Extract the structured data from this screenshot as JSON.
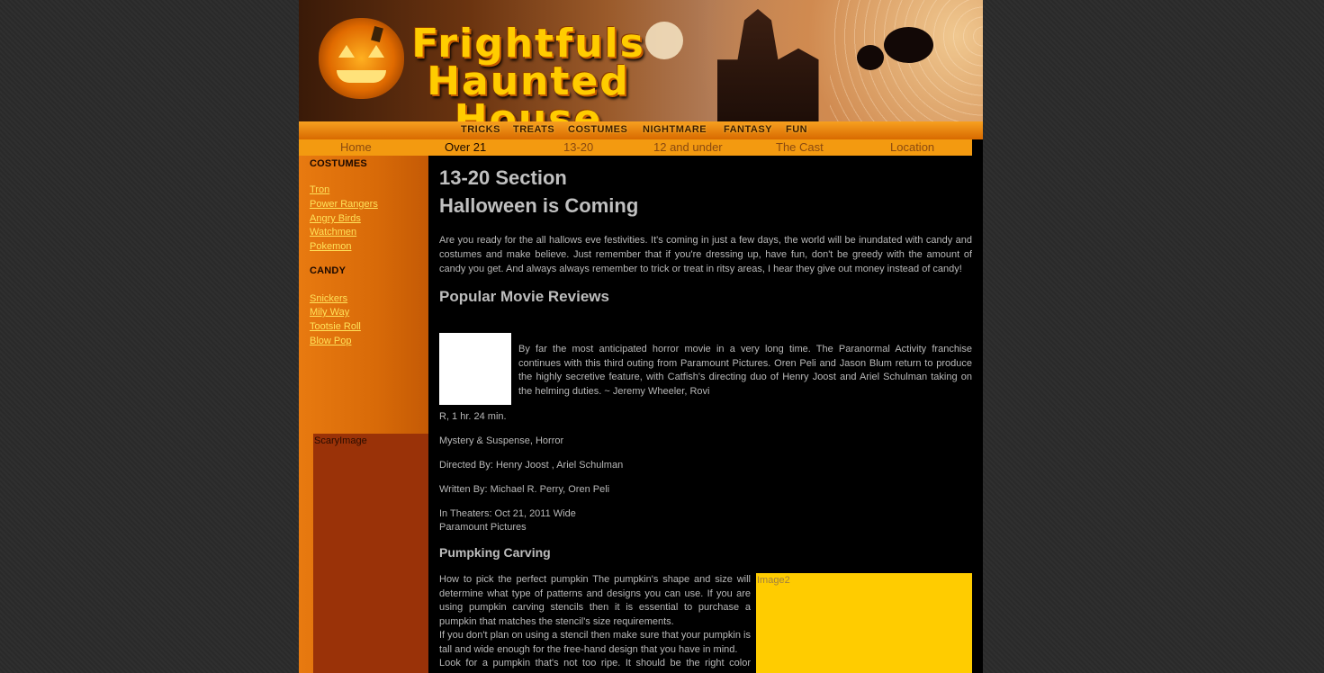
{
  "banner": {
    "logo_line1": "Frightfuls",
    "logo_line2": "Haunted House"
  },
  "top_menu": [
    "TRICKS",
    "TREATS",
    "COSTUMES",
    "NIGHTMARE",
    "FANTASY",
    "FUN"
  ],
  "nav": {
    "home": "Home",
    "over21": "Over 21",
    "teens": "13-20",
    "under12": "12 and under",
    "cast": "The Cast",
    "location": "Location",
    "active": "Over 21"
  },
  "sidebar": {
    "costumes_heading": "COSTUMES",
    "costumes": [
      "Tron",
      "Power Rangers",
      "Angry Birds",
      "Watchmen",
      "Pokemon"
    ],
    "candy_heading": "CANDY",
    "candy": [
      "Snickers",
      "Mily Way",
      "Tootsie Roll",
      "Blow Pop"
    ],
    "image_label": "ScaryImage"
  },
  "main": {
    "section_title": "13-20 Section",
    "headline": "Halloween is Coming",
    "intro": "Are you ready for the all hallows eve festivities. It's coming in just a few days, the world will be inundated with candy and costumes and make believe. Just remember that if you're dressing up, have fun, don't be greedy with the amount of candy you get. And always always remember to trick or treat in ritsy areas, I hear they give out money instead of candy!",
    "reviews_heading": "Popular Movie Reviews",
    "review_text": "By far the most anticipated horror movie in a very long time. The Paranormal Activity franchise continues with this third outing from Paramount Pictures. Oren Peli and Jason Blum return to produce the highly secretive feature, with Catfish's directing duo of Henry Joost and Ariel Schulman taking on the helming duties. ~ Jeremy Wheeler, Rovi",
    "rating": "R, 1 hr. 24 min.",
    "genre": "Mystery & Suspense, Horror",
    "directed": "Directed By: Henry Joost , Ariel Schulman",
    "written": "Written By: Michael R. Perry, Oren Peli",
    "theaters": "In Theaters: Oct 21, 2011 Wide",
    "studio": "Paramount Pictures",
    "carving_heading": "Pumpking Carving",
    "carving_p1": "How to pick the perfect pumpkin The pumpkin's shape and size will determine what type of patterns and designs you can use. If you are using pumpkin carving stencils then it is essential to purchase a pumpkin that matches the stencil's size requirements.",
    "carving_p2": "If you don't plan on using a stencil then make sure that your pumpkin is tall and wide enough for the free-hand design that you have in mind.",
    "carving_p3": "Look for a pumpkin that's not too ripe. It should be the right color orange",
    "image2_label": "Image2"
  },
  "colors": {
    "nav_bg": "#f39a10",
    "sidebar_bg": "#d86a08",
    "link": "#ffe25a",
    "main_bg": "#000000",
    "image2_bg": "#ffcc00"
  }
}
